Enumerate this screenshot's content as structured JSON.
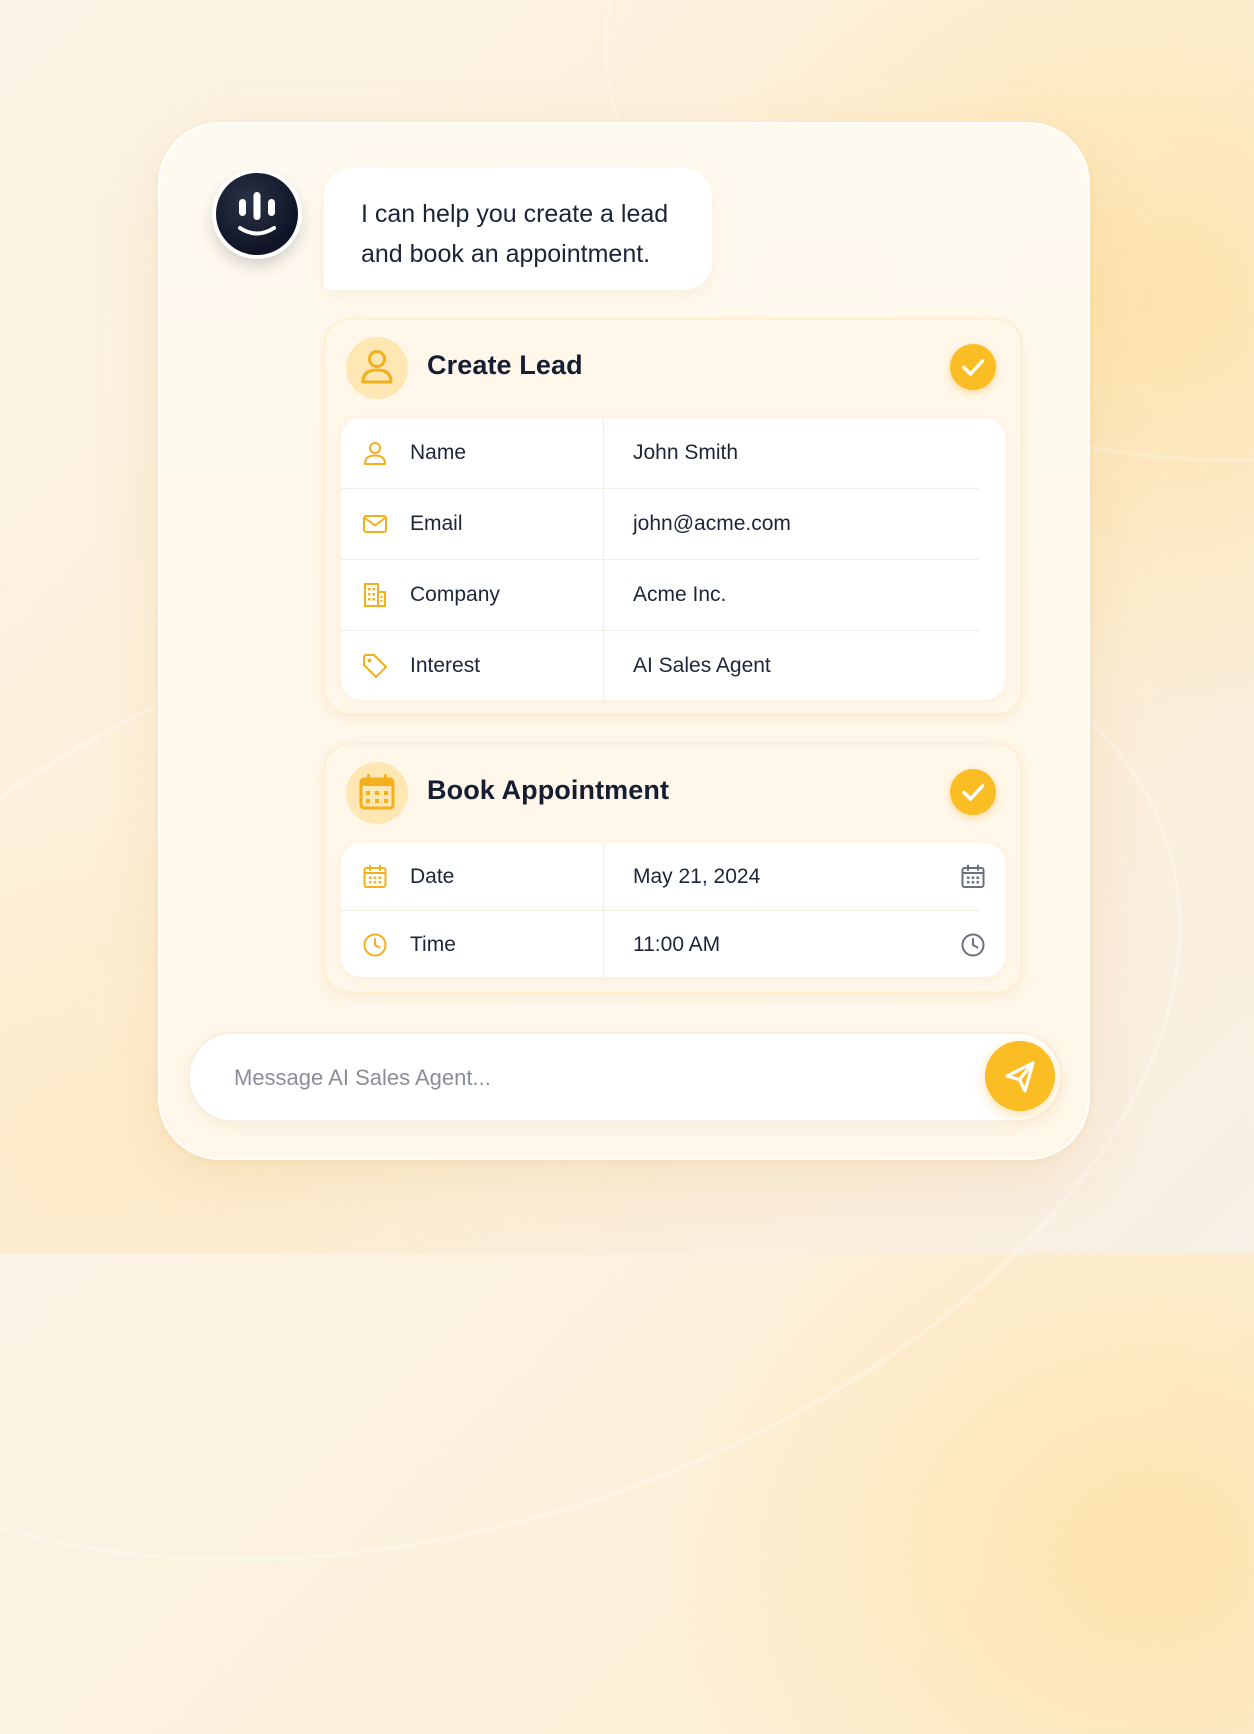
{
  "colors": {
    "accent": "#fbbd24",
    "icon_accent": "#f2b01e",
    "text_primary": "#18213a",
    "placeholder": "#8a8e99",
    "avatar_bg": "#0f1526"
  },
  "assistant": {
    "avatar_icon": "voice-wave-icon",
    "message_lines": [
      "I can help you create a lead",
      "and book an appointment."
    ]
  },
  "lead_card": {
    "icon": "user-icon",
    "title": "Create Lead",
    "status_icon": "check-icon",
    "rows": [
      {
        "icon": "user-icon",
        "label": "Name",
        "value": "John Smith"
      },
      {
        "icon": "mail-icon",
        "label": "Email",
        "value": "john@acme.com"
      },
      {
        "icon": "building-icon",
        "label": "Company",
        "value": "Acme Inc."
      },
      {
        "icon": "tag-icon",
        "label": "Interest",
        "value": "AI Sales Agent"
      }
    ]
  },
  "appointment_card": {
    "icon": "calendar-icon",
    "title": "Book Appointment",
    "status_icon": "check-icon",
    "rows": [
      {
        "icon": "calendar-icon",
        "label": "Date",
        "value": "May 21, 2024",
        "trailing_icon": "calendar-icon"
      },
      {
        "icon": "clock-icon",
        "label": "Time",
        "value": "11:00 AM",
        "trailing_icon": "clock-icon"
      }
    ]
  },
  "composer": {
    "placeholder": "Message AI Sales Agent...",
    "value": "",
    "send_icon": "send-icon"
  }
}
